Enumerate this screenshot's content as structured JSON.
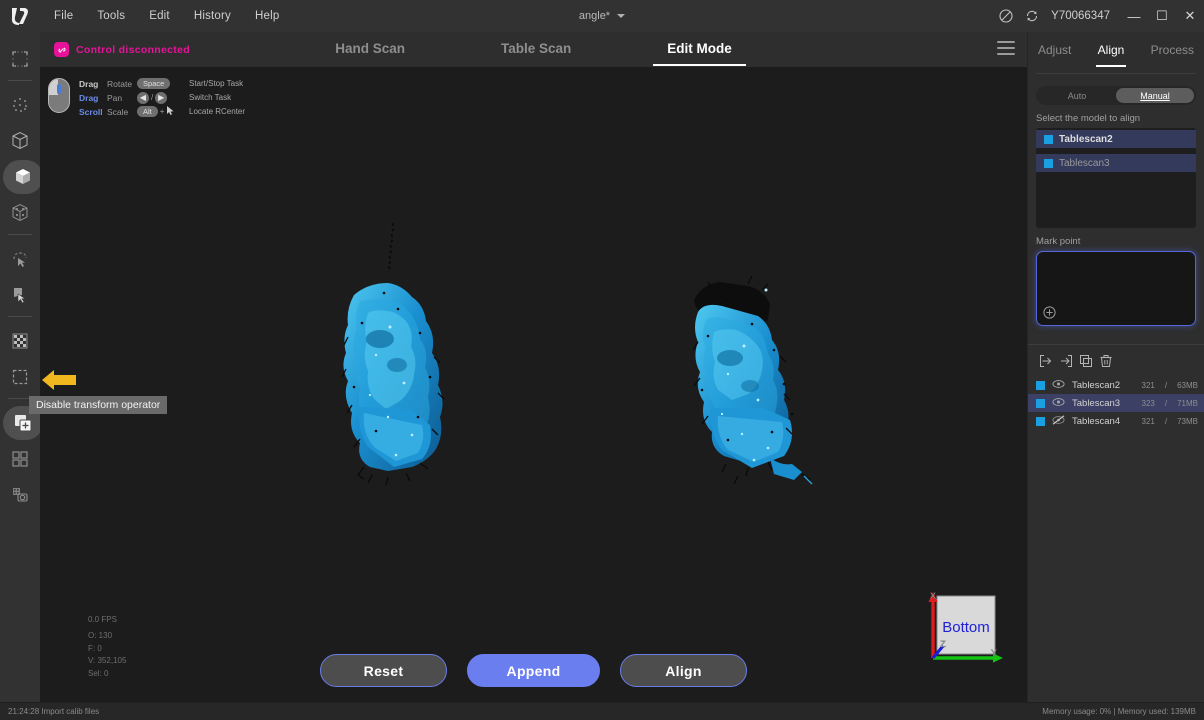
{
  "titlebar": {
    "logo_name": "app-logo",
    "menus": [
      "File",
      "Tools",
      "Edit",
      "History",
      "Help"
    ],
    "document_name": "angle*",
    "serial": "Y70066347",
    "icons": [
      "no-entry-icon",
      "refresh-icon"
    ],
    "window_buttons": {
      "minimize": "—",
      "maximize": "☐",
      "close": "✕"
    }
  },
  "rail": {
    "items": [
      {
        "name": "select-frame-icon",
        "active": false
      },
      {
        "name": "point-cloud-icon",
        "active": false
      },
      {
        "name": "wireframe-cube-icon",
        "active": false
      },
      {
        "name": "solid-cube-icon",
        "active": true
      },
      {
        "name": "textured-cube-icon",
        "active": false
      },
      {
        "name": "lasso-select-icon",
        "active": false
      },
      {
        "name": "rect-brush-select-icon",
        "active": false
      },
      {
        "name": "checker-pattern-icon",
        "active": false
      },
      {
        "name": "square-select-icon",
        "active": false
      },
      {
        "name": "transform-operator-icon",
        "active": true
      },
      {
        "name": "grid-four-icon",
        "active": false
      },
      {
        "name": "camera-capture-icon",
        "active": false
      }
    ]
  },
  "viewport": {
    "connection": {
      "label": "Control disconnected",
      "icon": "link-broken-icon",
      "color": "#e8129a"
    },
    "tabs": [
      {
        "label": "Hand Scan",
        "active": false
      },
      {
        "label": "Table Scan",
        "active": false
      },
      {
        "label": "Edit Mode",
        "active": true
      }
    ],
    "menu_icon": "hamburger-menu-icon",
    "mouse_help": {
      "rows": [
        {
          "action": "Drag",
          "mode": "Rotate",
          "key": "Space",
          "desc": "Start/Stop Task",
          "highlight": false
        },
        {
          "action": "Drag",
          "mode": "Pan",
          "key": "arrows",
          "desc": "Switch Task",
          "highlight": true
        },
        {
          "action": "Scroll",
          "mode": "Scale",
          "key": "Alt",
          "desc": "Locate RCenter",
          "highlight": true
        }
      ]
    },
    "stats": {
      "fps": "0.0 FPS",
      "objects": "O: 130",
      "faces": "F: 0",
      "vertices": "V: 352,105",
      "selected": "Sel: 0"
    },
    "gizmo": {
      "face_label": "Bottom",
      "x_label": "X",
      "y_label": "Y",
      "z_label": "Z"
    },
    "tooltip": "Disable transform operator",
    "actions": [
      {
        "label": "Reset",
        "primary": false
      },
      {
        "label": "Append",
        "primary": true
      },
      {
        "label": "Align",
        "primary": false
      }
    ]
  },
  "right_panel": {
    "tabs": [
      {
        "label": "Adjust",
        "active": false
      },
      {
        "label": "Align",
        "active": true
      },
      {
        "label": "Process",
        "active": false
      }
    ],
    "mode_segments": [
      {
        "label": "Auto",
        "active": false
      },
      {
        "label": "Manual",
        "active": true
      }
    ],
    "select_label": "Select the model to align",
    "select_items": [
      {
        "name": "Tablescan2",
        "selected": true
      },
      {
        "name": "Tablescan3",
        "selected": true
      }
    ],
    "markpoint_label": "Mark point",
    "markpoint_add_icon": "add-circle-icon",
    "list_toolbar": [
      {
        "name": "import-icon"
      },
      {
        "name": "export-icon"
      },
      {
        "name": "duplicate-icon"
      },
      {
        "name": "delete-icon"
      }
    ],
    "models": [
      {
        "name": "Tablescan2",
        "count": "321",
        "size": "63MB",
        "visible": true,
        "selected": false
      },
      {
        "name": "Tablescan3",
        "count": "323",
        "size": "71MB",
        "visible": true,
        "selected": true
      },
      {
        "name": "Tablescan4",
        "count": "321",
        "size": "73MB",
        "visible": false,
        "selected": false
      }
    ]
  },
  "statusbar": {
    "left": "21:24:28 Import calib files",
    "right": "Memory usage: 0% | Memory used: 139MB"
  },
  "colors": {
    "accent_blue": "#6b7ef0",
    "magenta": "#e8129a",
    "model_cyan": "#1a9fe0",
    "axis_x": "#e01b1b",
    "axis_y": "#12c412",
    "axis_z": "#1b1be0"
  }
}
